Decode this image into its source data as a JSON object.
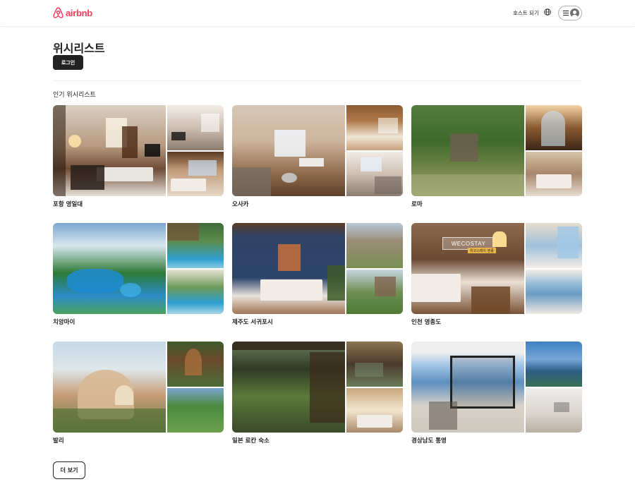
{
  "header": {
    "logo_text": "airbnb",
    "host_link": "호스트 되기"
  },
  "page": {
    "title": "위시리스트",
    "login_button": "로그인",
    "section_title": "인기 위시리스트",
    "more_button": "더 보기"
  },
  "wishlists": [
    {
      "label": "포항 영일대"
    },
    {
      "label": "오사카"
    },
    {
      "label": "로마"
    },
    {
      "label": "치앙마이"
    },
    {
      "label": "제주도 서귀포시"
    },
    {
      "label": "인천 영종도",
      "sign_text": "WECOSTAY",
      "sign_sub": "위코스테이 영종"
    },
    {
      "label": "발리"
    },
    {
      "label": "일본 료칸 숙소"
    },
    {
      "label": "경상남도 통영"
    }
  ],
  "colors": {
    "brand": "#ff385c",
    "text": "#222222",
    "divider": "#ebebeb",
    "button_dark": "#222222"
  },
  "icons": [
    "airbnb-logo-icon",
    "globe-icon",
    "menu-icon",
    "user-avatar-icon"
  ]
}
